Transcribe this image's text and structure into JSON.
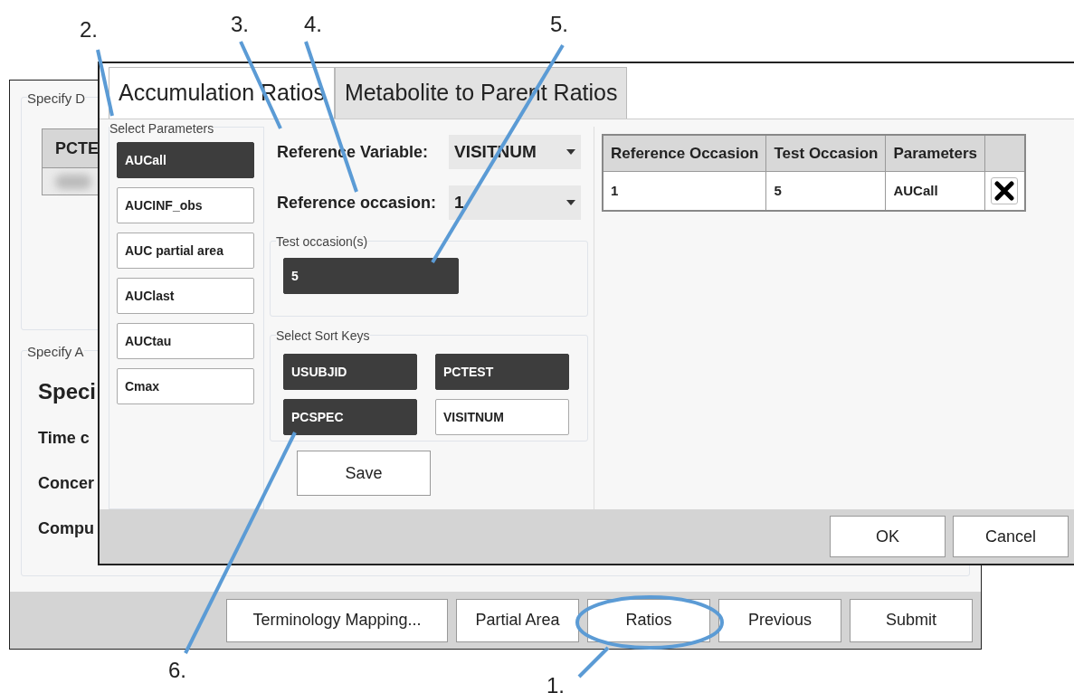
{
  "background_window": {
    "group_1": {
      "title": "Specify D",
      "table_header": "PCTE"
    },
    "group_2": {
      "title": "Specify A",
      "heading": "Speci",
      "fields": [
        "Time c",
        "Concer",
        "Compu"
      ]
    },
    "buttons": [
      {
        "label": "Terminology Mapping..."
      },
      {
        "label": "Partial Area"
      },
      {
        "label": "Ratios"
      },
      {
        "label": "Previous"
      },
      {
        "label": "Submit"
      }
    ]
  },
  "dialog": {
    "tabs": [
      {
        "label": "Accumulation Ratios",
        "selected": true
      },
      {
        "label": "Metabolite to Parent Ratios",
        "selected": false
      }
    ],
    "parameters": {
      "title": "Select Parameters",
      "items": [
        {
          "label": "AUCall",
          "selected": true
        },
        {
          "label": "AUCINF_obs",
          "selected": false
        },
        {
          "label": "AUC partial area",
          "selected": false
        },
        {
          "label": "AUClast",
          "selected": false
        },
        {
          "label": "AUCtau",
          "selected": false
        },
        {
          "label": "Cmax",
          "selected": false
        }
      ]
    },
    "reference_variable": {
      "label": "Reference Variable:",
      "value": "VISITNUM"
    },
    "reference_occasion": {
      "label": "Reference occasion:",
      "value": "1"
    },
    "test_occasions": {
      "title": "Test occasion(s)",
      "items": [
        {
          "label": "5",
          "selected": true
        }
      ]
    },
    "sort_keys": {
      "title": "Select Sort Keys",
      "items": [
        {
          "label": "USUBJID",
          "selected": true
        },
        {
          "label": "PCTEST",
          "selected": true
        },
        {
          "label": "PCSPEC",
          "selected": true
        },
        {
          "label": "VISITNUM",
          "selected": false
        }
      ]
    },
    "save_button": "Save",
    "table": {
      "columns": [
        "Reference Occasion",
        "Test Occasion",
        "Parameters"
      ],
      "rows": [
        [
          "1",
          "5",
          "AUCall"
        ]
      ]
    },
    "buttons": [
      {
        "label": "OK"
      },
      {
        "label": "Cancel"
      }
    ]
  },
  "annotations": [
    {
      "label": "1."
    },
    {
      "label": "2."
    },
    {
      "label": "3."
    },
    {
      "label": "4."
    },
    {
      "label": "5."
    },
    {
      "label": "6."
    }
  ]
}
